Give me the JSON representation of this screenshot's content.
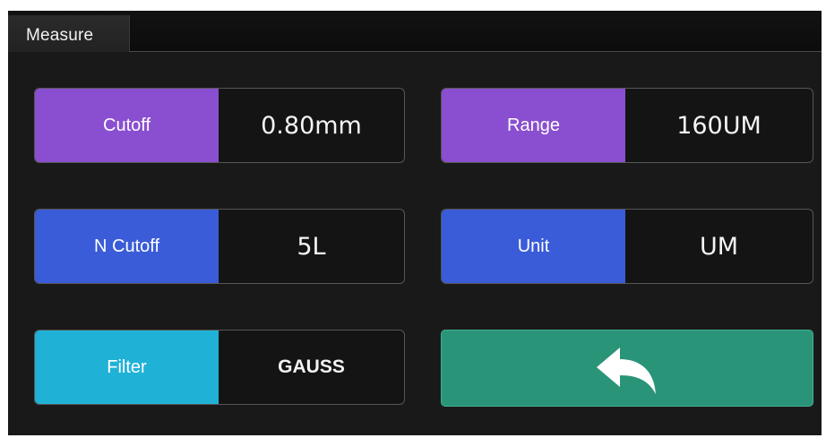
{
  "header": {
    "title": "Measure"
  },
  "fields": {
    "cutoff": {
      "label": "Cutoff",
      "value": "0.80mm"
    },
    "range": {
      "label": "Range",
      "value": "160UM"
    },
    "n_cutoff": {
      "label": "N Cutoff",
      "value": "5L"
    },
    "unit": {
      "label": "Unit",
      "value": "UM"
    },
    "filter": {
      "label": "Filter",
      "value": "GAUSS"
    }
  },
  "back_button": {
    "icon": "back-arrow-icon"
  },
  "colors": {
    "screen_bg": "#1a1919",
    "purple": "#8a4fd0",
    "blue": "#3a5cd8",
    "cyan": "#20b2d6",
    "green": "#2a9479"
  }
}
